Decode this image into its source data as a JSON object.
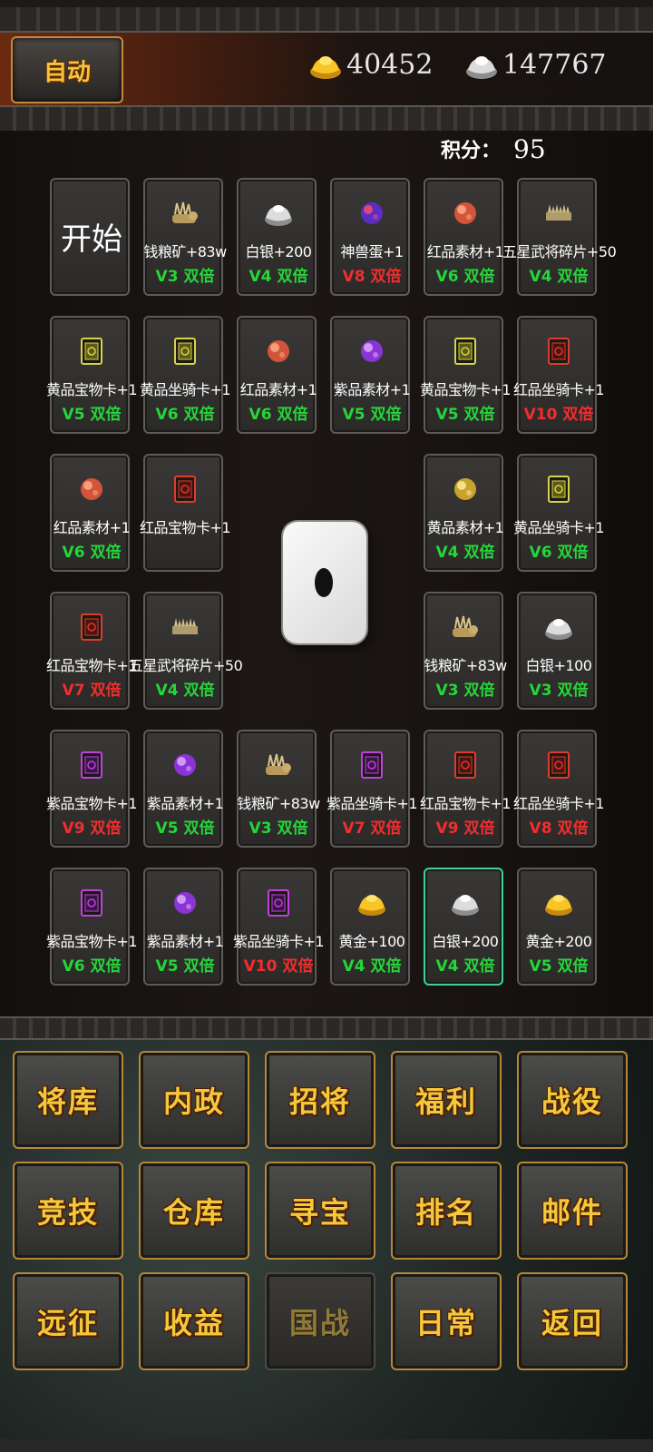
{
  "header": {
    "auto_label": "自动",
    "gold": "40452",
    "silver": "147767"
  },
  "score": {
    "label": "积分：",
    "value": "95"
  },
  "board": {
    "start_label": "开始",
    "cells": [
      {
        "name": "钱粮矿+83w",
        "bonus": "V3 双倍",
        "bonus_color": "green",
        "icon": "grain-ore-icon"
      },
      {
        "name": "白银+200",
        "bonus": "V4 双倍",
        "bonus_color": "green",
        "icon": "silver-ingot-icon"
      },
      {
        "name": "神兽蛋+1",
        "bonus": "V8 双倍",
        "bonus_color": "red",
        "icon": "beast-egg-icon"
      },
      {
        "name": "红品素材+1",
        "bonus": "V6 双倍",
        "bonus_color": "green",
        "icon": "red-gem-icon"
      },
      {
        "name": "五星武将碎片+50",
        "bonus": "V4 双倍",
        "bonus_color": "green",
        "icon": "general-shard-icon"
      },
      {
        "name": "黄品宝物卡+1",
        "bonus": "V5 双倍",
        "bonus_color": "green",
        "icon": "yellow-card-icon"
      },
      {
        "name": "黄品坐骑卡+1",
        "bonus": "V6 双倍",
        "bonus_color": "green",
        "icon": "yellow-mount-card-icon"
      },
      {
        "name": "红品素材+1",
        "bonus": "V6 双倍",
        "bonus_color": "green",
        "icon": "red-gem-icon"
      },
      {
        "name": "紫品素材+1",
        "bonus": "V5 双倍",
        "bonus_color": "green",
        "icon": "purple-gem-icon"
      },
      {
        "name": "黄品宝物卡+1",
        "bonus": "V5 双倍",
        "bonus_color": "green",
        "icon": "yellow-card-icon"
      },
      {
        "name": "红品坐骑卡+1",
        "bonus": "V10 双倍",
        "bonus_color": "red",
        "icon": "red-mount-card-icon"
      },
      {
        "name": "红品素材+1",
        "bonus": "V6 双倍",
        "bonus_color": "green",
        "icon": "red-gem-icon"
      },
      {
        "name": "红品宝物卡+1",
        "bonus": "",
        "bonus_color": "green",
        "icon": "red-card-icon"
      },
      {
        "name": "黄品素材+1",
        "bonus": "V4 双倍",
        "bonus_color": "green",
        "icon": "yellow-gem-icon"
      },
      {
        "name": "黄品坐骑卡+1",
        "bonus": "V6 双倍",
        "bonus_color": "green",
        "icon": "yellow-mount-card-icon"
      },
      {
        "name": "红品宝物卡+1",
        "bonus": "V7 双倍",
        "bonus_color": "red",
        "icon": "red-card-icon"
      },
      {
        "name": "五星武将碎片+50",
        "bonus": "V4 双倍",
        "bonus_color": "green",
        "icon": "general-shard-icon"
      },
      {
        "name": "钱粮矿+83w",
        "bonus": "V3 双倍",
        "bonus_color": "green",
        "icon": "grain-ore-icon"
      },
      {
        "name": "白银+100",
        "bonus": "V3 双倍",
        "bonus_color": "green",
        "icon": "silver-ingot-icon"
      },
      {
        "name": "紫品宝物卡+1",
        "bonus": "V9 双倍",
        "bonus_color": "red",
        "icon": "purple-card-icon"
      },
      {
        "name": "紫品素材+1",
        "bonus": "V5 双倍",
        "bonus_color": "green",
        "icon": "purple-gem-icon"
      },
      {
        "name": "钱粮矿+83w",
        "bonus": "V3 双倍",
        "bonus_color": "green",
        "icon": "grain-ore-icon"
      },
      {
        "name": "紫品坐骑卡+1",
        "bonus": "V7 双倍",
        "bonus_color": "red",
        "icon": "purple-mount-card-icon"
      },
      {
        "name": "红品宝物卡+1",
        "bonus": "V9 双倍",
        "bonus_color": "red",
        "icon": "red-card-icon"
      },
      {
        "name": "红品坐骑卡+1",
        "bonus": "V8 双倍",
        "bonus_color": "red",
        "icon": "red-mount-card-icon"
      },
      {
        "name": "紫品宝物卡+1",
        "bonus": "V6 双倍",
        "bonus_color": "green",
        "icon": "purple-card-icon"
      },
      {
        "name": "紫品素材+1",
        "bonus": "V5 双倍",
        "bonus_color": "green",
        "icon": "purple-gem-icon"
      },
      {
        "name": "紫品坐骑卡+1",
        "bonus": "V10 双倍",
        "bonus_color": "red",
        "icon": "purple-mount-card-icon"
      },
      {
        "name": "黄金+100",
        "bonus": "V4 双倍",
        "bonus_color": "green",
        "icon": "gold-ingot-icon"
      },
      {
        "name": "白银+200",
        "bonus": "V4 双倍",
        "bonus_color": "green",
        "icon": "silver-ingot-icon",
        "selected": true
      },
      {
        "name": "黄金+200",
        "bonus": "V5 双倍",
        "bonus_color": "green",
        "icon": "gold-ingot-icon"
      }
    ],
    "die_value": 1
  },
  "menu": {
    "buttons": [
      {
        "label": "将库"
      },
      {
        "label": "内政"
      },
      {
        "label": "招将"
      },
      {
        "label": "福利"
      },
      {
        "label": "战役"
      },
      {
        "label": "竞技"
      },
      {
        "label": "仓库"
      },
      {
        "label": "寻宝"
      },
      {
        "label": "排名"
      },
      {
        "label": "邮件"
      },
      {
        "label": "远征"
      },
      {
        "label": "收益"
      },
      {
        "label": "国战",
        "disabled": true
      },
      {
        "label": "日常"
      },
      {
        "label": "返回"
      }
    ]
  },
  "colors": {
    "bonus_green": "#25d639",
    "bonus_red": "#f32d2d",
    "menu_gold": "#f5c83b",
    "selected_border": "#3fd09a"
  }
}
